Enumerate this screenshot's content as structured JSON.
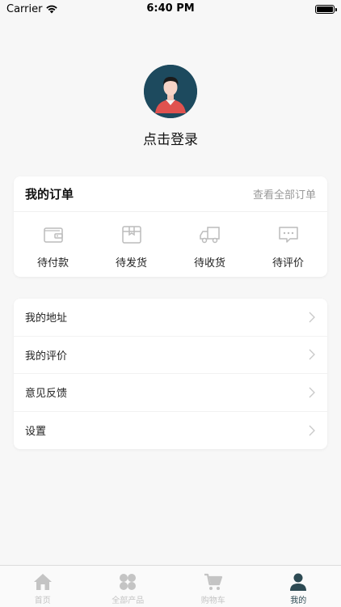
{
  "status_bar": {
    "carrier": "Carrier",
    "time": "6:40 PM"
  },
  "profile": {
    "login_text": "点击登录",
    "avatar_icon": "user-avatar-icon"
  },
  "orders": {
    "title": "我的订单",
    "view_all": "查看全部订单",
    "items": [
      {
        "label": "待付款",
        "icon": "wallet-icon"
      },
      {
        "label": "待发货",
        "icon": "package-icon"
      },
      {
        "label": "待收货",
        "icon": "truck-icon"
      },
      {
        "label": "待评价",
        "icon": "comment-icon"
      }
    ]
  },
  "menu": {
    "items": [
      {
        "label": "我的地址"
      },
      {
        "label": "我的评价"
      },
      {
        "label": "意见反馈"
      },
      {
        "label": "设置"
      }
    ]
  },
  "tabbar": {
    "items": [
      {
        "label": "首页",
        "icon": "home-icon"
      },
      {
        "label": "全部产品",
        "icon": "grid-icon"
      },
      {
        "label": "购物车",
        "icon": "cart-icon"
      },
      {
        "label": "我的",
        "icon": "user-icon"
      }
    ],
    "active_index": 3
  },
  "colors": {
    "accent": "#2d4a53",
    "inactive": "#c4c4c4",
    "background": "#f7f7f7"
  }
}
